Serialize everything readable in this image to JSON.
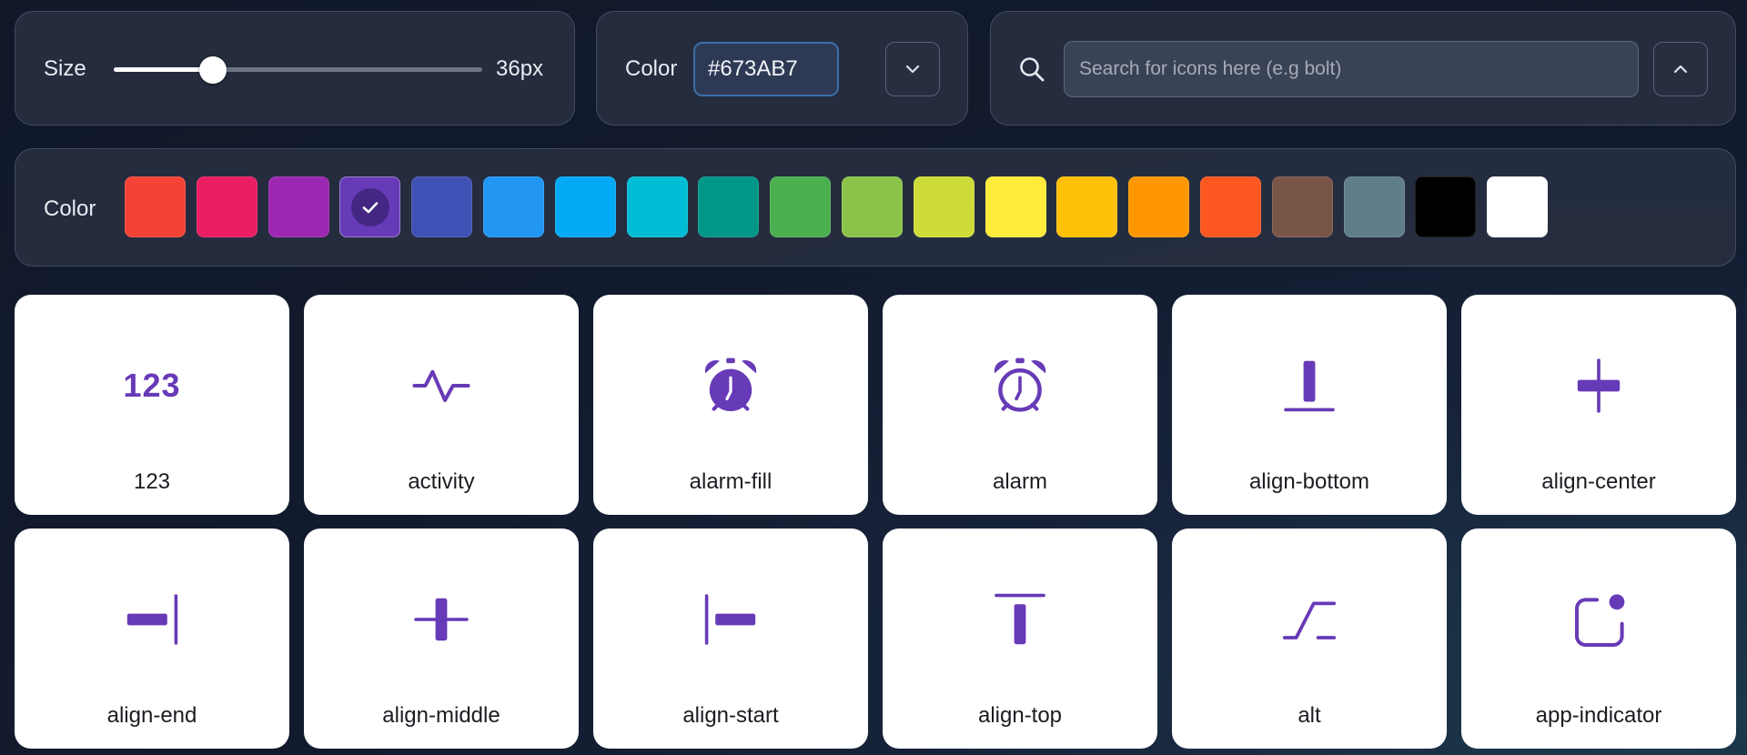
{
  "size_control": {
    "label": "Size",
    "value_text": "36px",
    "value_fraction": 0.27
  },
  "color_control": {
    "label": "Color",
    "hex_value": "#673AB7",
    "dropdown_icon": "chevron-down-icon"
  },
  "search": {
    "placeholder": "Search for icons here (e.g bolt)",
    "value": "",
    "icon": "search-icon",
    "collapse_icon": "chevron-up-icon"
  },
  "palette": {
    "label": "Color",
    "selected_index": 3,
    "swatches": [
      {
        "name": "red",
        "color": "#F44336"
      },
      {
        "name": "pink",
        "color": "#E91E63"
      },
      {
        "name": "purple",
        "color": "#9C27B0"
      },
      {
        "name": "deep-purple",
        "color": "#673AB7"
      },
      {
        "name": "indigo",
        "color": "#3F51B5"
      },
      {
        "name": "blue",
        "color": "#2196F3"
      },
      {
        "name": "light-blue",
        "color": "#03A9F4"
      },
      {
        "name": "cyan",
        "color": "#00BCD4"
      },
      {
        "name": "teal",
        "color": "#009688"
      },
      {
        "name": "green",
        "color": "#4CAF50"
      },
      {
        "name": "light-green",
        "color": "#8BC34A"
      },
      {
        "name": "lime",
        "color": "#CDDC39"
      },
      {
        "name": "yellow",
        "color": "#FFEB3B"
      },
      {
        "name": "amber",
        "color": "#FFC107"
      },
      {
        "name": "orange",
        "color": "#FF9800"
      },
      {
        "name": "deep-orange",
        "color": "#FF5722"
      },
      {
        "name": "brown",
        "color": "#795548"
      },
      {
        "name": "blue-grey",
        "color": "#607D8B"
      },
      {
        "name": "black",
        "color": "#000000"
      },
      {
        "name": "white",
        "color": "#FFFFFF"
      }
    ]
  },
  "icon_color": "#673AB7",
  "icons": [
    {
      "name": "123",
      "glyph_text": "123"
    },
    {
      "name": "activity"
    },
    {
      "name": "alarm-fill"
    },
    {
      "name": "alarm"
    },
    {
      "name": "align-bottom"
    },
    {
      "name": "align-center"
    },
    {
      "name": "align-end"
    },
    {
      "name": "align-middle"
    },
    {
      "name": "align-start"
    },
    {
      "name": "align-top"
    },
    {
      "name": "alt"
    },
    {
      "name": "app-indicator"
    }
  ]
}
